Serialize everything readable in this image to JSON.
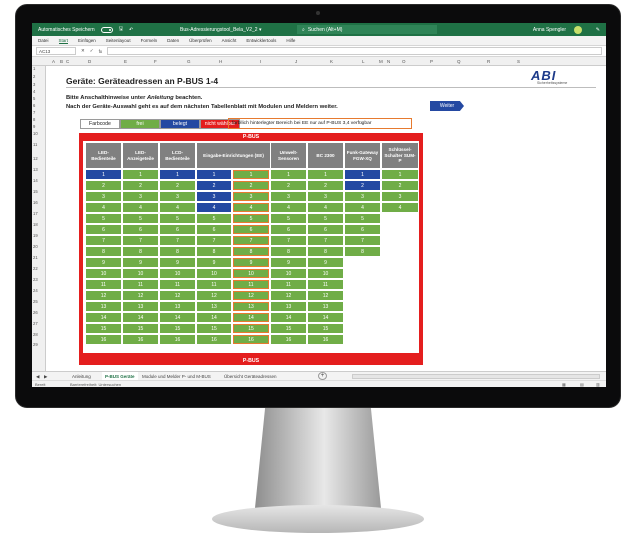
{
  "app": {
    "autosave_label": "Automatisches Speichern",
    "doc_title": "Bus-Adressierungstool_Bela_V2_2 ▾",
    "search_placeholder": "Suchen (Alt+M)",
    "user_name": "Anna Spengler"
  },
  "ribbon": {
    "tabs": [
      "Datei",
      "Start",
      "Einfügen",
      "Seitenlayout",
      "Formeln",
      "Daten",
      "Überprüfen",
      "Ansicht",
      "Entwicklertools",
      "Hilfe"
    ]
  },
  "formula_bar": {
    "name_box": "AC13",
    "fx": "fx"
  },
  "columns": [
    "A",
    "B",
    "C",
    "D",
    "E",
    "F",
    "G",
    "H",
    "I",
    "J",
    "K",
    "L",
    "M",
    "N",
    "O",
    "P",
    "Q",
    "R",
    "S"
  ],
  "rows": [
    "1",
    "2",
    "3",
    "4",
    "5",
    "6",
    "7",
    "8",
    "9",
    "10",
    "11",
    "12",
    "13",
    "14",
    "15",
    "16",
    "17",
    "18",
    "19",
    "20",
    "21",
    "22",
    "23",
    "24",
    "25",
    "26",
    "27",
    "28",
    "29"
  ],
  "sheet": {
    "title": "Geräte: Geräteadressen an P-BUS 1-4",
    "logo_text": "ABI",
    "logo_sub": "Sicherheitssysteme",
    "instr_1_pre": "Bitte Anschalthinweise unter ",
    "instr_1_em": "Anleitung",
    "instr_1_post": " beachten.",
    "instr_2": "Nach der Geräte-Auswahl geht es auf dem nächsten Tabellenblatt mit Modulen und Meldern weiter.",
    "weiter": "Weiter",
    "legend": {
      "farbcode": "Farbcode",
      "frei": "frei",
      "belegt": "belegt",
      "nicht_waehlbar": "nicht wählbar"
    },
    "note": "farbllich hinterlegter Bereich bei EE nur auf P-BUS 3,4 verfügbar",
    "pbus_label": "P-BUS",
    "headers": [
      "LED-Bedienteile",
      "LED-Anzeigeteile",
      "LCD-Bedienteile",
      "Eingabe-Einrichtungen (EE)",
      "",
      "Umwelt-Sensoren",
      "BC 2300",
      "Funk-Gateway FGW-XQ",
      "Schlüssel-Schalter SUM-P"
    ],
    "grid": [
      [
        "1",
        "1",
        "1",
        "1",
        "1",
        "1",
        "1",
        "1",
        "1"
      ],
      [
        "2",
        "2",
        "2",
        "2",
        "2",
        "2",
        "2",
        "2",
        "2"
      ],
      [
        "3",
        "3",
        "3",
        "3",
        "3",
        "3",
        "3",
        "3",
        "3"
      ],
      [
        "4",
        "4",
        "4",
        "4",
        "4",
        "4",
        "4",
        "4",
        "4"
      ],
      [
        "5",
        "5",
        "5",
        "5",
        "5",
        "5",
        "5",
        "5",
        ""
      ],
      [
        "6",
        "6",
        "6",
        "6",
        "6",
        "6",
        "6",
        "6",
        ""
      ],
      [
        "7",
        "7",
        "7",
        "7",
        "7",
        "7",
        "7",
        "7",
        ""
      ],
      [
        "8",
        "8",
        "8",
        "8",
        "8",
        "8",
        "8",
        "8",
        ""
      ],
      [
        "9",
        "9",
        "9",
        "9",
        "9",
        "9",
        "9",
        "",
        ""
      ],
      [
        "10",
        "10",
        "10",
        "10",
        "10",
        "10",
        "10",
        "",
        ""
      ],
      [
        "11",
        "11",
        "11",
        "11",
        "11",
        "11",
        "11",
        "",
        ""
      ],
      [
        "12",
        "12",
        "12",
        "12",
        "12",
        "12",
        "12",
        "",
        ""
      ],
      [
        "13",
        "13",
        "13",
        "13",
        "13",
        "13",
        "13",
        "",
        ""
      ],
      [
        "14",
        "14",
        "14",
        "14",
        "14",
        "14",
        "14",
        "",
        ""
      ],
      [
        "15",
        "15",
        "15",
        "15",
        "15",
        "15",
        "15",
        "",
        ""
      ],
      [
        "16",
        "16",
        "16",
        "16",
        "16",
        "16",
        "16",
        "",
        ""
      ]
    ],
    "cell_colors": {
      "frei": "#70ad47",
      "belegt": "#2449a2",
      "nicht_waehlbar": "#e41e1e",
      "ee_outline": "#e67a2f"
    },
    "belegt_cells": [
      [
        0,
        0
      ],
      [
        0,
        2
      ],
      [
        0,
        3
      ],
      [
        0,
        7
      ],
      [
        1,
        3
      ],
      [
        2,
        3
      ],
      [
        3,
        3
      ],
      [
        1,
        7
      ]
    ]
  },
  "tabs": {
    "items": [
      "Anleitung",
      "P-BUS Geräte",
      "Module und Melder P- und M-BUS",
      "Übersicht Geräteadressen"
    ],
    "active": 1
  },
  "status": {
    "ready": "Bereit",
    "accessibility": "Barrierefreiheit: Untersuchen"
  }
}
